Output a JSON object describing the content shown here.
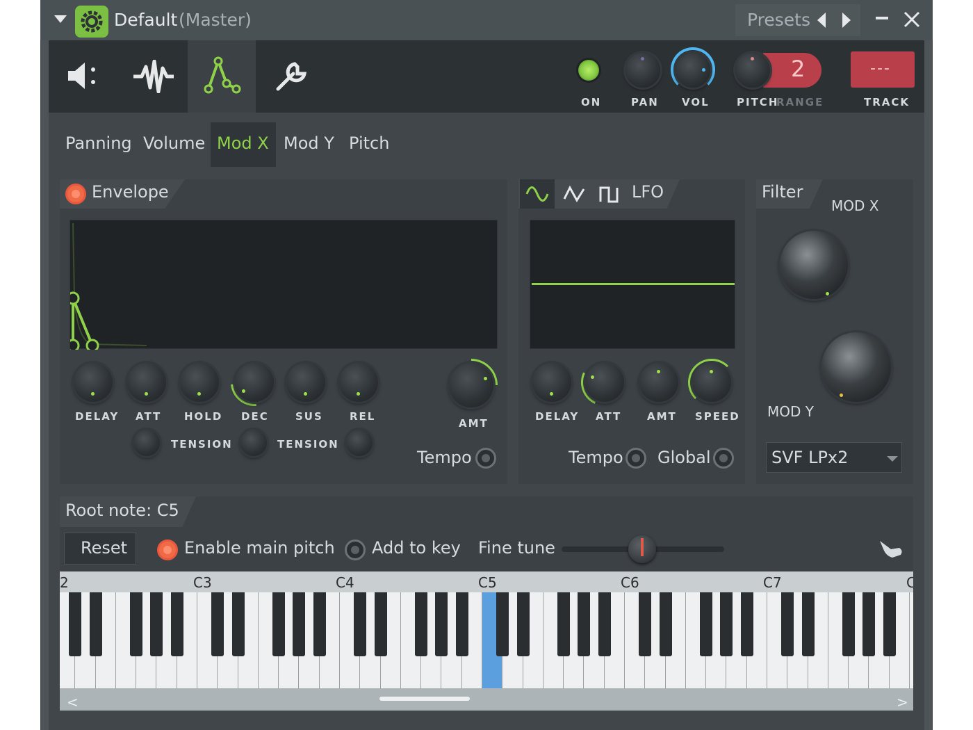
{
  "titlebar": {
    "preset_name": "Default",
    "preset_suffix": "(Master)",
    "presets_label": "Presets"
  },
  "plugin_tabs": [
    "speaker-icon",
    "waveform-icon",
    "envelope-icon",
    "wrench-icon"
  ],
  "header_controls": {
    "on": "ON",
    "pan": "PAN",
    "vol": "VOL",
    "pitch": "PITCH",
    "range": "RANGE",
    "range_value": "2",
    "track": "TRACK",
    "track_value": "---"
  },
  "target_tabs": [
    "Panning",
    "Volume",
    "Mod X",
    "Mod Y",
    "Pitch"
  ],
  "colors": {
    "accent": "#8fd24a",
    "active_radio": "#f06a48",
    "track_bg": "#b9404a"
  },
  "envelope": {
    "title": "Envelope",
    "knobs": [
      "DELAY",
      "ATT",
      "HOLD",
      "DEC",
      "SUS",
      "REL"
    ],
    "tension_labels": [
      "TENSION",
      "TENSION"
    ],
    "amt_label": "AMT",
    "tempo_label": "Tempo"
  },
  "lfo": {
    "title": "LFO",
    "knobs": [
      "DELAY",
      "ATT",
      "AMT",
      "SPEED"
    ],
    "tempo_label": "Tempo",
    "global_label": "Global"
  },
  "filter": {
    "title": "Filter",
    "mod_x": "MOD X",
    "mod_y": "MOD Y",
    "type": "SVF LPx2"
  },
  "root": {
    "root_note": "Root note: C5",
    "reset_label": "Reset",
    "enable_main_pitch": "Enable main pitch",
    "add_to_key": "Add to key",
    "fine_tune": "Fine tune"
  },
  "keyboard": {
    "labels": [
      "2",
      "C3",
      "C4",
      "C5",
      "C6",
      "C7",
      "C"
    ],
    "highlighted": "C5"
  }
}
